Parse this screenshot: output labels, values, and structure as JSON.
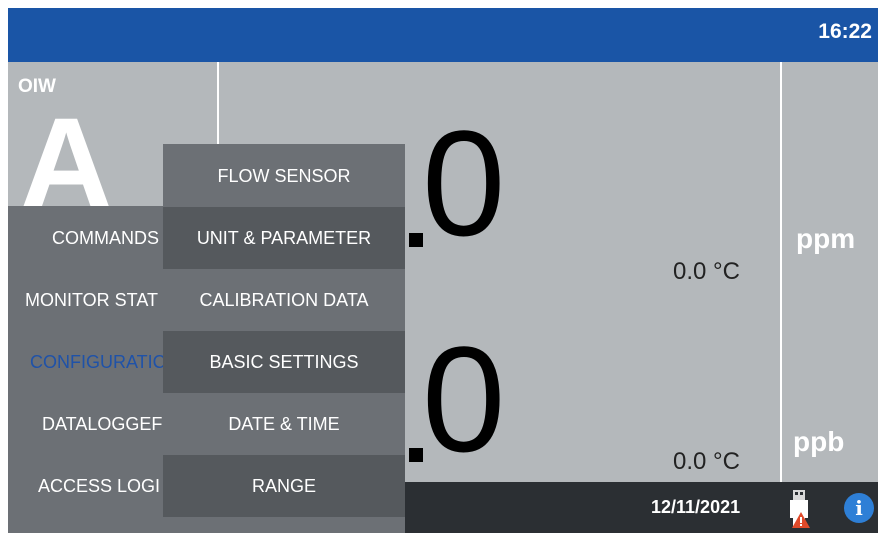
{
  "header": {
    "time": "16:22"
  },
  "channel": {
    "label": "OIW",
    "letter": "A"
  },
  "reading1": {
    "digit": "0",
    "temperature": "0.0 °C",
    "unit": "ppm"
  },
  "reading2": {
    "digit": "0",
    "temperature": "0.0 °C",
    "unit": "ppb"
  },
  "footer": {
    "date": "12/11/2021"
  },
  "main_menu": {
    "items": [
      {
        "label": "COMMANDS",
        "active": false
      },
      {
        "label": "MONITOR STAT",
        "active": false
      },
      {
        "label": "CONFIGURATIC",
        "active": true
      },
      {
        "label": "DATALOGGEF",
        "active": false
      },
      {
        "label": "ACCESS LOGI",
        "active": false
      }
    ]
  },
  "submenu": {
    "items": [
      {
        "label": "FLOW SENSOR"
      },
      {
        "label": "UNIT & PARAMETER"
      },
      {
        "label": "CALIBRATION DATA"
      },
      {
        "label": "BASIC SETTINGS"
      },
      {
        "label": "DATE & TIME"
      },
      {
        "label": "RANGE"
      }
    ]
  },
  "colors": {
    "header": "#1a55a6",
    "panel": "#b4b8bb",
    "menu": "#6c7075",
    "active_text": "#1f52a8",
    "info_icon": "#2e7fd6"
  },
  "icons": {
    "usb": "usb-warning-icon",
    "info": "info-icon"
  }
}
